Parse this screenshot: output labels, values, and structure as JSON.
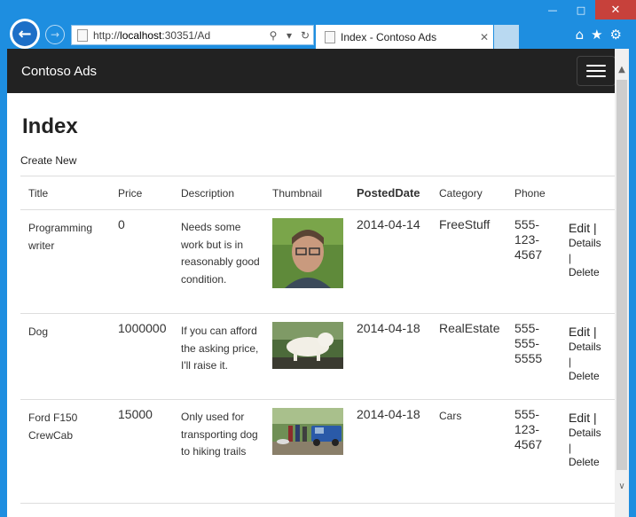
{
  "window": {
    "minimize_icon": "minimize-icon",
    "maximize_icon": "maximize-icon",
    "close_icon": "close-icon"
  },
  "browser": {
    "url_prefix": "http://",
    "url_host": "localhost",
    "url_rest": ":30351/Ad",
    "tab_title": "Index - Contoso Ads",
    "icons": [
      "back-arrow-icon",
      "forward-arrow-icon",
      "search-icon",
      "refresh-icon",
      "home-icon",
      "favorites-star-icon",
      "settings-gear-icon"
    ]
  },
  "navbar": {
    "brand": "Contoso Ads"
  },
  "page": {
    "title": "Index",
    "create_new": "Create New"
  },
  "table": {
    "headers": [
      "Title",
      "Price",
      "Description",
      "Thumbnail",
      "PostedDate",
      "Category",
      "Phone"
    ],
    "rows": [
      {
        "title": "Programming writer",
        "price": "0",
        "description": "Needs some work but is in reasonably good condition.",
        "thumbnail": "portrait-thumbnail",
        "posted_date": "2014-04-14",
        "category": "FreeStuff",
        "phone": "555-123-4567"
      },
      {
        "title": "Dog",
        "price": "1000000",
        "description": "If you can afford the asking price, I'll raise it.",
        "thumbnail": "dog-thumbnail",
        "posted_date": "2014-04-18",
        "category": "RealEstate",
        "phone": "555-555-5555"
      },
      {
        "title": "Ford F150 CrewCab",
        "price": "15000",
        "description": "Only used for transporting dog to hiking trails",
        "thumbnail": "truck-thumbnail",
        "posted_date": "2014-04-18",
        "category": "Cars",
        "phone": "555-123-4567"
      }
    ],
    "actions": {
      "edit": "Edit",
      "details": "Details",
      "delete": "Delete",
      "separator": "|"
    }
  }
}
